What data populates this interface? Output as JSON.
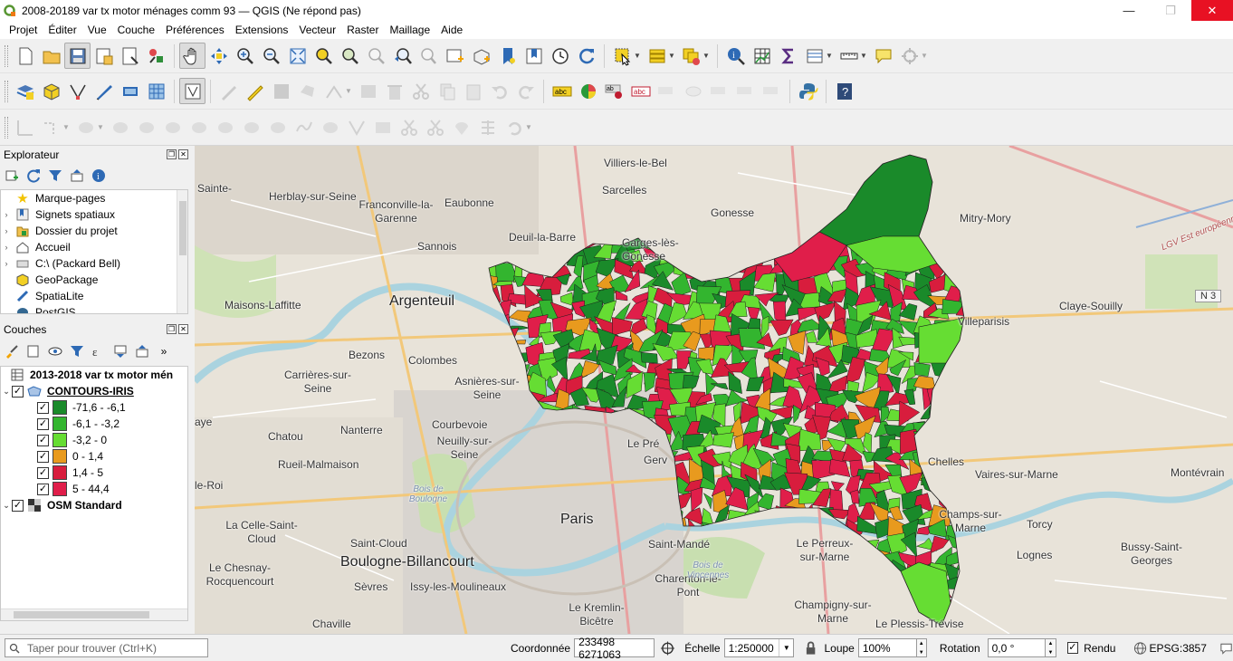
{
  "window": {
    "title": "2008-20189 var tx motor ménages comm 93 — QGIS (Ne répond pas)",
    "minimize": "—",
    "maximize": "❐",
    "close": "✕"
  },
  "menu": [
    "Projet",
    "Éditer",
    "Vue",
    "Couche",
    "Préférences",
    "Extensions",
    "Vecteur",
    "Raster",
    "Maillage",
    "Aide"
  ],
  "explorer": {
    "title": "Explorateur",
    "items": [
      {
        "label": "Marque-pages",
        "icon": "star-icon",
        "expandable": false
      },
      {
        "label": "Signets spatiaux",
        "icon": "spatial-bookmark-icon",
        "expandable": true
      },
      {
        "label": "Dossier du projet",
        "icon": "project-folder-icon",
        "expandable": true
      },
      {
        "label": "Accueil",
        "icon": "home-icon",
        "expandable": true
      },
      {
        "label": "C:\\ (Packard Bell)",
        "icon": "drive-icon",
        "expandable": true
      },
      {
        "label": "GeoPackage",
        "icon": "geopackage-icon",
        "expandable": false
      },
      {
        "label": "SpatiaLite",
        "icon": "spatialite-icon",
        "expandable": false
      },
      {
        "label": "PostGIS",
        "icon": "postgis-icon",
        "expandable": false
      }
    ]
  },
  "layers": {
    "title": "Couches",
    "group": "2013-2018 var tx motor mén",
    "layer1": "CONTOURS-IRIS",
    "classes": [
      {
        "label": "-71,6 - -6,1",
        "color": "#1a8a2a"
      },
      {
        "label": "-6,1 - -3,2",
        "color": "#33b52f"
      },
      {
        "label": "-3,2 - 0",
        "color": "#66dd33"
      },
      {
        "label": "0 - 1,4",
        "color": "#e89a1e"
      },
      {
        "label": "1,4 - 5",
        "color": "#d81d3d"
      },
      {
        "label": "5 - 44,4",
        "color": "#e01e4a"
      }
    ],
    "layer2": "OSM Standard"
  },
  "map_labels": [
    {
      "t": "Villiers-le-Bel",
      "cls": ""
    },
    {
      "t": "Sarcelles",
      "cls": ""
    },
    {
      "t": "Herblay-sur-Seine",
      "cls": ""
    },
    {
      "t": "Franconville-la-Garenne",
      "cls": ""
    },
    {
      "t": "Eaubonne",
      "cls": ""
    },
    {
      "t": "Gonesse",
      "cls": ""
    },
    {
      "t": "Mitry-Mory",
      "cls": ""
    },
    {
      "t": "Deuil-la-Barre",
      "cls": ""
    },
    {
      "t": "Garges-lès-Gonesse",
      "cls": ""
    },
    {
      "t": "Sannois",
      "cls": ""
    },
    {
      "t": "Maisons-Laffitte",
      "cls": ""
    },
    {
      "t": "Argenteuil",
      "cls": "big"
    },
    {
      "t": "Claye-Souilly",
      "cls": ""
    },
    {
      "t": "Villeparisis",
      "cls": ""
    },
    {
      "t": "Bezons",
      "cls": ""
    },
    {
      "t": "Colombes",
      "cls": ""
    },
    {
      "t": "Carrières-sur-Seine",
      "cls": ""
    },
    {
      "t": "Asnières-sur-Seine",
      "cls": ""
    },
    {
      "t": "Nanterre",
      "cls": ""
    },
    {
      "t": "Courbevoie",
      "cls": ""
    },
    {
      "t": "Chatou",
      "cls": ""
    },
    {
      "t": "Neuilly-sur-Seine",
      "cls": ""
    },
    {
      "t": "Rueil-Malmaison",
      "cls": ""
    },
    {
      "t": "Chelles",
      "cls": ""
    },
    {
      "t": "Vaires-sur-Marne",
      "cls": ""
    },
    {
      "t": "Montévrain",
      "cls": ""
    },
    {
      "t": "Paris",
      "cls": "big"
    },
    {
      "t": "La Celle-Saint-Cloud",
      "cls": ""
    },
    {
      "t": "Saint-Cloud",
      "cls": ""
    },
    {
      "t": "Boulogne-Billancourt",
      "cls": "big"
    },
    {
      "t": "Saint-Mandé",
      "cls": ""
    },
    {
      "t": "Le Perreux-sur-Marne",
      "cls": ""
    },
    {
      "t": "Champs-sur-Marne",
      "cls": ""
    },
    {
      "t": "Torcy",
      "cls": ""
    },
    {
      "t": "Lognes",
      "cls": ""
    },
    {
      "t": "Bussy-Saint-Georges",
      "cls": ""
    },
    {
      "t": "Le Chesnay-Rocquencourt",
      "cls": ""
    },
    {
      "t": "Sèvres",
      "cls": ""
    },
    {
      "t": "Issy-les-Moulineaux",
      "cls": ""
    },
    {
      "t": "Charenton-le-Pont",
      "cls": ""
    },
    {
      "t": "Champigny-sur-Marne",
      "cls": ""
    },
    {
      "t": "Le Kremlin-Bicêtre",
      "cls": ""
    },
    {
      "t": "Le Plessis-Trévise",
      "cls": ""
    },
    {
      "t": "Chaville",
      "cls": ""
    },
    {
      "t": "Bois de Boulogne",
      "cls": "water"
    },
    {
      "t": "Bois de Vincennes",
      "cls": "water"
    },
    {
      "t": "N 3",
      "cls": "shield"
    },
    {
      "t": "LGV Est européenne",
      "cls": "road"
    },
    {
      "t": "Le Pré",
      "cls": ""
    },
    {
      "t": "Gerv",
      "cls": ""
    },
    {
      "t": "Sainte-",
      "cls": ""
    },
    {
      "t": "aye",
      "cls": ""
    },
    {
      "t": "le-Roi",
      "cls": ""
    }
  ],
  "statusbar": {
    "search_placeholder": "Taper pour trouver (Ctrl+K)",
    "coord_label": "Coordonnée",
    "coord_value": "233498 6271063",
    "scale_label": "Échelle",
    "scale_value": "1:250000",
    "magnifier_label": "Loupe",
    "magnifier_value": "100%",
    "rotation_label": "Rotation",
    "rotation_value": "0,0 °",
    "render_label": "Rendu",
    "crs": "EPSG:3857"
  }
}
